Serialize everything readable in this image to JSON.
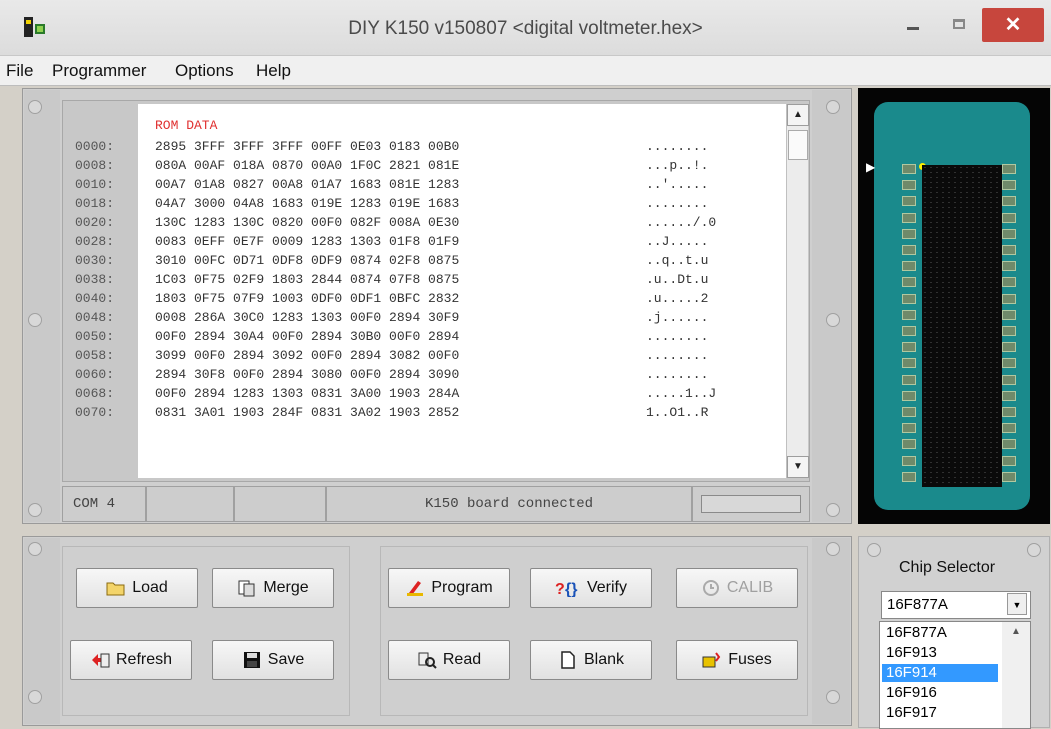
{
  "window": {
    "title": "DIY K150 v150807   <digital voltmeter.hex>",
    "close_glyph": "✕"
  },
  "menu": [
    "File",
    "Programmer",
    "Options",
    "Help"
  ],
  "hex": {
    "label": "ROM DATA",
    "addresses": [
      "0000:",
      "0008:",
      "0010:",
      "0018:",
      "0020:",
      "0028:",
      "0030:",
      "0038:",
      "0040:",
      "0048:",
      "0050:",
      "0058:",
      "0060:",
      "0068:",
      "0070:"
    ],
    "rows": [
      "2895 3FFF 3FFF 3FFF 00FF 0E03 0183 00B0",
      "080A 00AF 018A 0870 00A0 1F0C 2821 081E",
      "00A7 01A8 0827 00A8 01A7 1683 081E 1283",
      "04A7 3000 04A8 1683 019E 1283 019E 1683",
      "130C 1283 130C 0820 00F0 082F 008A 0E30",
      "0083 0EFF 0E7F 0009 1283 1303 01F8 01F9",
      "3010 00FC 0D71 0DF8 0DF9 0874 02F8 0875",
      "1C03 0F75 02F9 1803 2844 0874 07F8 0875",
      "1803 0F75 07F9 1003 0DF0 0DF1 0BFC 2832",
      "0008 286A 30C0 1283 1303 00F0 2894 30F9",
      "00F0 2894 30A4 00F0 2894 30B0 00F0 2894",
      "3099 00F0 2894 3092 00F0 2894 3082 00F0",
      "2894 30F8 00F0 2894 3080 00F0 2894 3090",
      "00F0 2894 1283 1303 0831 3A00 1903 284A",
      "0831 3A01 1903 284F 0831 3A02 1903 2852"
    ],
    "ascii": [
      "........",
      "...p..!.",
      "..'.....",
      "........",
      "....../.0",
      "..J.....",
      "..q..t.u",
      ".u..Dt.u",
      ".u.....2",
      ".j......",
      "........",
      "........",
      "........",
      ".....1..J",
      "1..O1..R"
    ]
  },
  "status": {
    "port": "COM 4",
    "message": "K150 board connected"
  },
  "buttons": {
    "load": "Load",
    "merge": "Merge",
    "refresh": "Refresh",
    "save": "Save",
    "program": "Program",
    "verify": "Verify",
    "calib": "CALIB",
    "read": "Read",
    "blank": "Blank",
    "fuses": "Fuses"
  },
  "chip_selector": {
    "title": "Chip Selector",
    "selected": "16F877A",
    "options": [
      "16F877A",
      "16F913",
      "16F914",
      "16F916",
      "16F917"
    ],
    "highlighted": "16F914"
  },
  "colors": {
    "rom_label": "#e03030",
    "chip_board": "#1a8a8c",
    "close_button": "#c7463d",
    "list_highlight": "#3399ff"
  }
}
